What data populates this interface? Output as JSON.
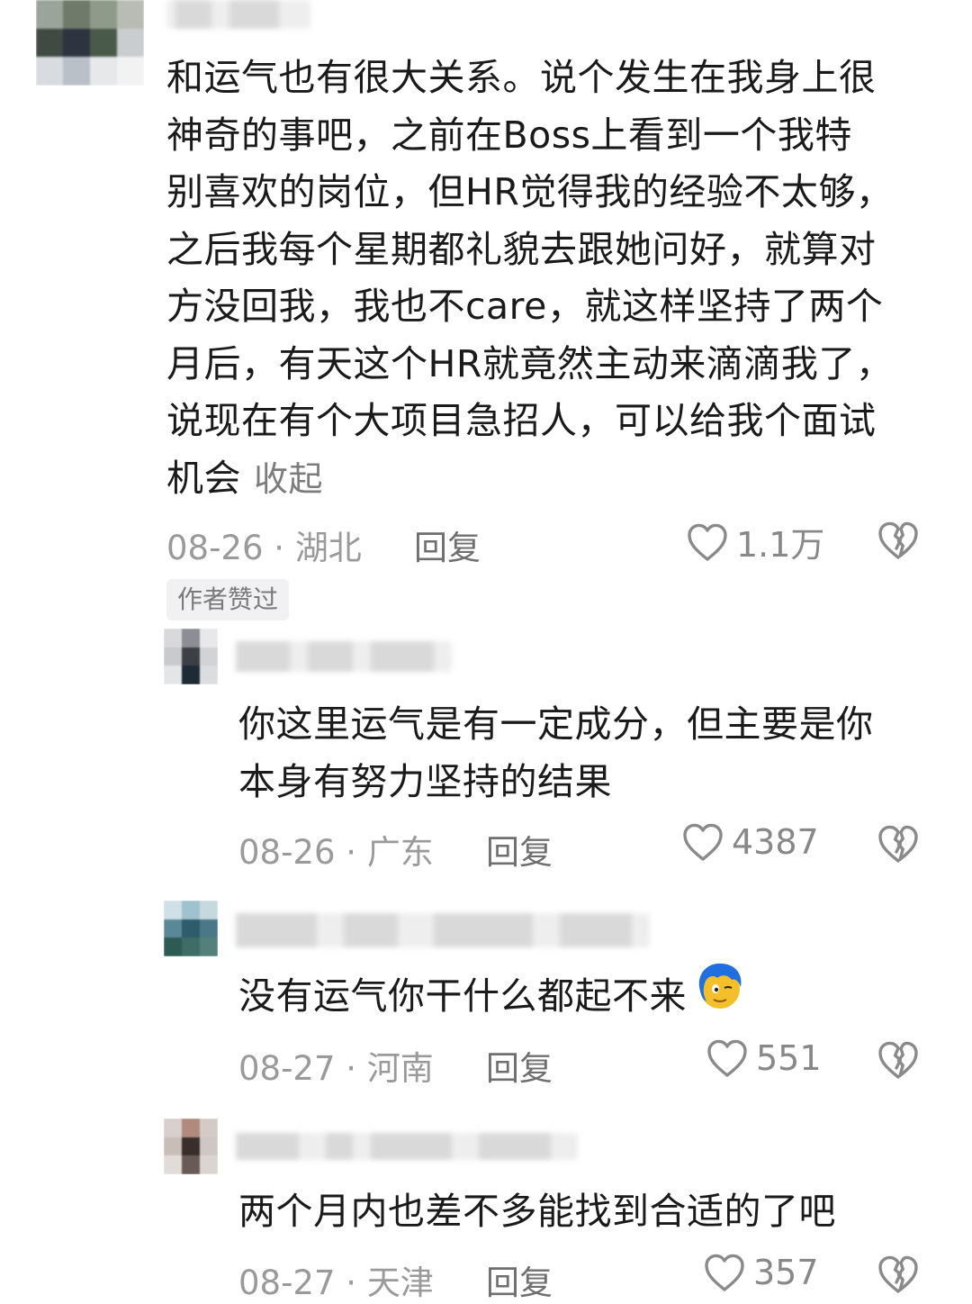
{
  "comments": [
    {
      "lines": [
        "和运气也有很大关系。说个发生在我身上很",
        "神奇的事吧，之前在Boss上看到一个我特",
        "别喜欢的岗位，但HR觉得我的经验不太够，",
        "之后我每个星期都礼貌去跟她问好，就算对",
        "方没回我，我也不care，就这样坚持了两个",
        "月后，有天这个HR就竟然主动来滴滴我了，",
        "说现在有个大项目急招人，可以给我个面试",
        "机会"
      ],
      "collapse_label": "收起",
      "date": "08-26",
      "location": "湖北",
      "reply_label": "回复",
      "likes": "1.1万",
      "badge": "作者赞过"
    },
    {
      "lines": [
        "你这里运气是有一定成分，但主要是你",
        "本身有努力坚持的结果"
      ],
      "date": "08-26",
      "location": "广东",
      "reply_label": "回复",
      "likes": "4387"
    },
    {
      "lines": [
        "没有运气你干什么都起不来"
      ],
      "emoji": "blue-hair-face-emoji",
      "date": "08-27",
      "location": "河南",
      "reply_label": "回复",
      "likes": "551"
    },
    {
      "lines": [
        "两个月内也差不多能找到合适的了吧"
      ],
      "date": "08-27",
      "location": "天津",
      "reply_label": "回复",
      "likes": "357"
    }
  ],
  "separator": " · ",
  "icons": {
    "like": "heart-outline-icon",
    "dislike": "broken-heart-icon"
  }
}
